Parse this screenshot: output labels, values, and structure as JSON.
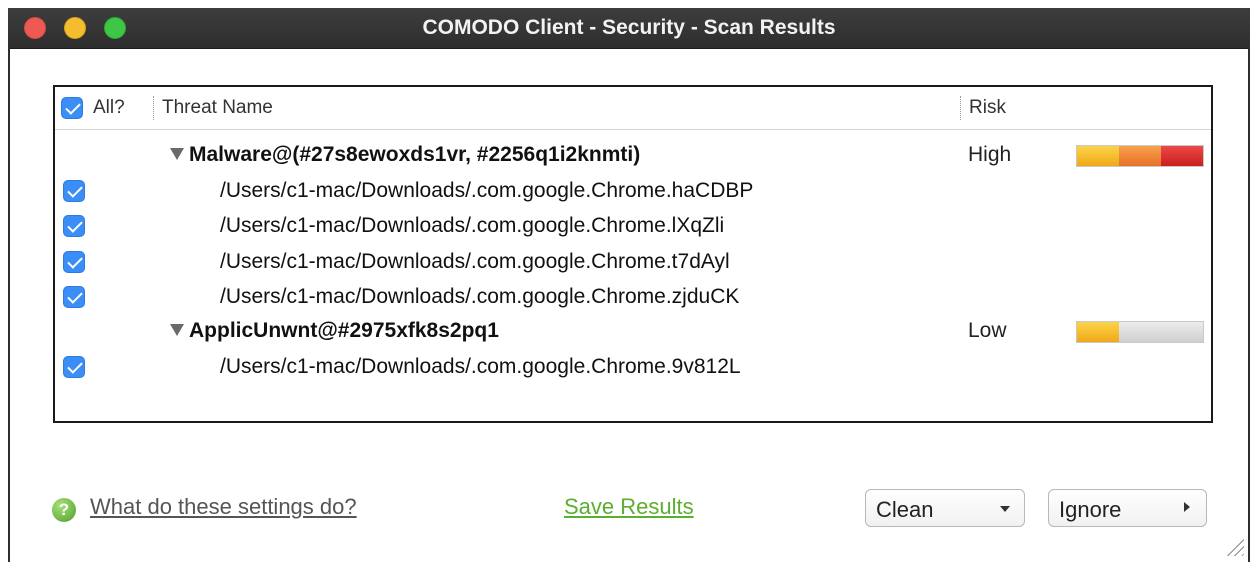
{
  "window": {
    "title": "COMODO Client - Security - Scan Results"
  },
  "table": {
    "select_all_label": "All?",
    "col_threat": "Threat Name",
    "col_risk": "Risk",
    "groups": [
      {
        "name": "Malware@(#27s8ewoxds1vr, #2256q1i2knmti)",
        "risk": "High",
        "risk_level": 1.0,
        "items": [
          "/Users/c1-mac/Downloads/.com.google.Chrome.haCDBP",
          "/Users/c1-mac/Downloads/.com.google.Chrome.lXqZli",
          "/Users/c1-mac/Downloads/.com.google.Chrome.t7dAyl",
          "/Users/c1-mac/Downloads/.com.google.Chrome.zjduCK"
        ]
      },
      {
        "name": "ApplicUnwnt@#2975xfk8s2pq1",
        "risk": "Low",
        "risk_level": 0.33,
        "items": [
          "/Users/c1-mac/Downloads/.com.google.Chrome.9v812L"
        ]
      }
    ]
  },
  "footer": {
    "help_icon": "?",
    "help_link": "What do these settings do?",
    "save_link": "Save Results",
    "clean_button": "Clean",
    "ignore_button": "Ignore"
  },
  "colors": {
    "checkbox": "#3a8ef6",
    "save_link": "#5cae2e",
    "risk_high": "#c91f1f",
    "risk_medium": "#e8702a",
    "risk_low": "#f0a818"
  }
}
